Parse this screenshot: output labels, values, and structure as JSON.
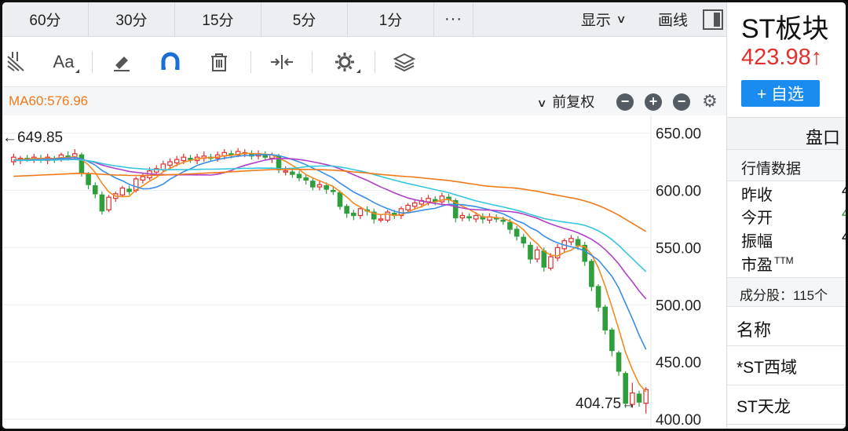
{
  "periods": {
    "items": [
      "60分",
      "30分",
      "15分",
      "5分",
      "1分"
    ],
    "more": "···",
    "show_label": "显示",
    "draw_label": "画线"
  },
  "toolbar": {
    "font_label": "Aa",
    "icons": [
      "fibonacci-icon",
      "font-icon",
      "eraser-icon",
      "magnet-icon",
      "trash-icon",
      "fit-width-icon",
      "settings-icon",
      "layers-icon"
    ]
  },
  "ma_bar": {
    "ma60": "MA60:576.96",
    "adjust_label": "前复权",
    "buttons": [
      "−",
      "+",
      "−",
      "⚙"
    ]
  },
  "chart_data": {
    "type": "candlestick",
    "y_ticks": [
      "650.00",
      "600.00",
      "550.00",
      "500.00",
      "450.00",
      "400.00"
    ],
    "ylim": [
      398,
      660
    ],
    "high_label": "649.85",
    "low_label": "404.75",
    "colors": {
      "up": "#e0302f",
      "down": "#2f9e3c",
      "ma_orange": "#f08a24",
      "ma_blue": "#3a8ee6",
      "ma_purple": "#b13fc8",
      "ma_cyan": "#36c7de",
      "ma60": "#f07a1a"
    },
    "candles": [
      [
        625,
        629,
        622,
        632
      ],
      [
        626,
        628,
        623,
        630
      ],
      [
        628,
        627,
        625,
        631
      ],
      [
        627,
        629,
        624,
        632
      ],
      [
        628,
        627,
        624,
        631
      ],
      [
        626,
        629,
        623,
        632
      ],
      [
        628,
        627,
        624,
        630
      ],
      [
        627,
        631,
        625,
        633
      ],
      [
        630,
        629,
        626,
        634
      ],
      [
        629,
        632,
        627,
        636
      ],
      [
        631,
        615,
        612,
        633
      ],
      [
        614,
        605,
        601,
        616
      ],
      [
        604,
        597,
        593,
        607
      ],
      [
        596,
        582,
        579,
        599
      ],
      [
        583,
        594,
        581,
        596
      ],
      [
        593,
        597,
        590,
        599
      ],
      [
        596,
        602,
        594,
        604
      ],
      [
        601,
        599,
        596,
        604
      ],
      [
        600,
        610,
        598,
        612
      ],
      [
        609,
        612,
        606,
        615
      ],
      [
        611,
        617,
        609,
        620
      ],
      [
        616,
        619,
        613,
        622
      ],
      [
        618,
        623,
        616,
        626
      ],
      [
        622,
        625,
        619,
        628
      ],
      [
        624,
        627,
        621,
        630
      ],
      [
        626,
        629,
        623,
        632
      ],
      [
        628,
        627,
        624,
        631
      ],
      [
        626,
        629,
        623,
        632
      ],
      [
        628,
        630,
        625,
        634
      ],
      [
        629,
        628,
        625,
        632
      ],
      [
        628,
        631,
        625,
        634
      ],
      [
        630,
        633,
        627,
        636
      ],
      [
        632,
        631,
        628,
        635
      ],
      [
        631,
        634,
        629,
        637
      ],
      [
        633,
        633,
        629,
        636
      ],
      [
        632,
        630,
        627,
        635
      ],
      [
        630,
        632,
        627,
        635
      ],
      [
        631,
        629,
        626,
        634
      ],
      [
        628,
        631,
        624,
        633
      ],
      [
        630,
        618,
        615,
        632
      ],
      [
        617,
        617,
        613,
        621
      ],
      [
        616,
        614,
        611,
        619
      ],
      [
        614,
        611,
        608,
        617
      ],
      [
        611,
        609,
        605,
        614
      ],
      [
        608,
        603,
        600,
        611
      ],
      [
        603,
        605,
        600,
        608
      ],
      [
        604,
        601,
        597,
        607
      ],
      [
        600,
        599,
        596,
        604
      ],
      [
        598,
        586,
        583,
        600
      ],
      [
        586,
        580,
        576,
        588
      ],
      [
        580,
        578,
        574,
        583
      ],
      [
        578,
        584,
        575,
        586
      ],
      [
        583,
        582,
        578,
        586
      ],
      [
        581,
        575,
        571,
        584
      ],
      [
        575,
        575,
        572,
        579
      ],
      [
        574,
        581,
        572,
        583
      ],
      [
        580,
        578,
        575,
        583
      ],
      [
        578,
        584,
        575,
        586
      ],
      [
        583,
        587,
        580,
        589
      ],
      [
        586,
        589,
        583,
        592
      ],
      [
        588,
        591,
        585,
        594
      ],
      [
        590,
        593,
        587,
        596
      ],
      [
        592,
        590,
        587,
        595
      ],
      [
        590,
        595,
        587,
        598
      ],
      [
        594,
        592,
        589,
        597
      ],
      [
        591,
        576,
        572,
        593
      ],
      [
        576,
        578,
        573,
        581
      ],
      [
        577,
        576,
        573,
        580
      ],
      [
        575,
        578,
        572,
        581
      ],
      [
        577,
        575,
        571,
        580
      ],
      [
        574,
        577,
        571,
        580
      ],
      [
        576,
        575,
        572,
        579
      ],
      [
        574,
        573,
        570,
        577
      ],
      [
        572,
        566,
        562,
        575
      ],
      [
        566,
        560,
        556,
        569
      ],
      [
        559,
        554,
        550,
        562
      ],
      [
        552,
        540,
        536,
        555
      ],
      [
        540,
        548,
        537,
        551
      ],
      [
        547,
        533,
        529,
        550
      ],
      [
        532,
        542,
        530,
        545
      ],
      [
        541,
        550,
        538,
        553
      ],
      [
        549,
        556,
        546,
        558
      ],
      [
        555,
        558,
        552,
        561
      ],
      [
        557,
        552,
        548,
        560
      ],
      [
        552,
        538,
        534,
        555
      ],
      [
        538,
        516,
        512,
        540
      ],
      [
        516,
        498,
        494,
        518
      ],
      [
        498,
        478,
        474,
        500
      ],
      [
        478,
        460,
        455,
        480
      ],
      [
        458,
        442,
        438,
        460
      ],
      [
        440,
        414,
        410,
        442
      ],
      [
        413,
        423,
        410,
        432
      ],
      [
        422,
        415,
        411,
        425
      ],
      [
        414,
        426,
        405,
        428
      ]
    ]
  },
  "right": {
    "title": "ST板块",
    "price": "423.98",
    "price_arrow": "↑",
    "add_label": "+ 自选",
    "pan_label": "盘口",
    "quote_header": "行情数据",
    "rows": [
      {
        "label": "昨收",
        "value": "4"
      },
      {
        "label": "今开",
        "value": "4"
      },
      {
        "label": "振幅",
        "value": "4"
      },
      {
        "label": "市盈",
        "sup": "TTM",
        "value": ""
      }
    ],
    "comp_label": "成分股：115个",
    "name_header": "名称",
    "stocks": [
      "*ST西域",
      "ST天龙"
    ]
  }
}
